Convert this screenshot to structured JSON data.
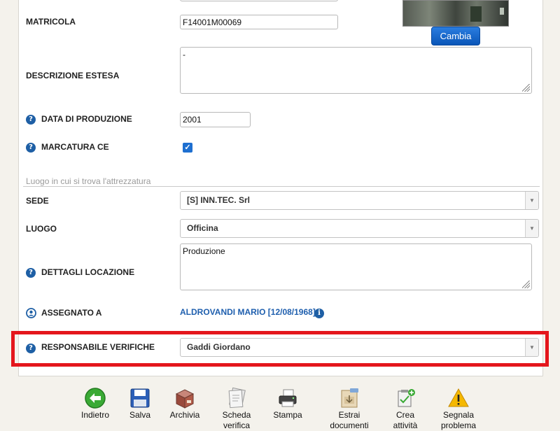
{
  "form": {
    "matricola": {
      "label": "MATRICOLA",
      "value": "F14001M00069"
    },
    "descrizione": {
      "label": "DESCRIZIONE ESTESA",
      "value": "-"
    },
    "data_produzione": {
      "label": "DATA DI PRODUZIONE",
      "value": "2001"
    },
    "marcatura": {
      "label": "MARCATURA CE",
      "checked": true
    },
    "photo": {
      "button": "Cambia"
    }
  },
  "location": {
    "section_title": "Luogo in cui si trova l'attrezzatura",
    "sede": {
      "label": "SEDE",
      "value": "[S] INN.TEC. Srl"
    },
    "luogo": {
      "label": "LUOGO",
      "value": "Officina"
    },
    "dettagli": {
      "label": "DETTAGLI LOCAZIONE",
      "value": "Produzione"
    },
    "assegnato": {
      "label": "ASSEGNATO A",
      "value": "ALDROVANDI MARIO [12/08/1968]"
    },
    "responsabile": {
      "label": "RESPONSABILE VERIFICHE",
      "value": "Gaddi Giordano"
    }
  },
  "toolbar": {
    "items": [
      {
        "line1": "Indietro",
        "line2": "",
        "icon": "back-arrow-icon"
      },
      {
        "line1": "Salva",
        "line2": "",
        "icon": "floppy-disk-icon"
      },
      {
        "line1": "Archivia",
        "line2": "",
        "icon": "archive-box-icon"
      },
      {
        "line1": "Scheda",
        "line2": "verifica",
        "icon": "document-stack-icon"
      },
      {
        "line1": "Stampa",
        "line2": "",
        "icon": "printer-icon"
      },
      {
        "line1": "Estrai",
        "line2": "documenti",
        "icon": "zip-extract-icon"
      },
      {
        "line1": "Crea",
        "line2": "attività",
        "icon": "create-task-icon"
      },
      {
        "line1": "Segnala",
        "line2": "problema",
        "icon": "warning-icon"
      }
    ]
  },
  "colors": {
    "highlight": "#e4161c",
    "accent": "#1e6fd0",
    "link": "#1f5fae"
  }
}
